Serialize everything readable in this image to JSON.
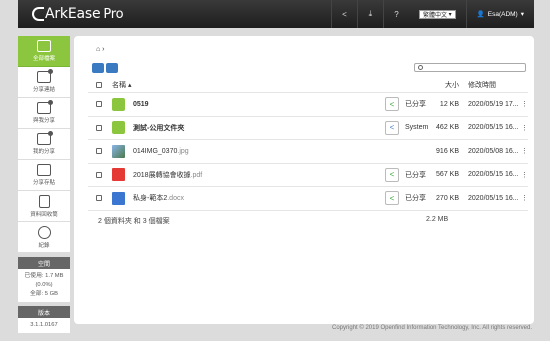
{
  "header": {
    "brand": "ArkEase",
    "brand_suffix": "Pro",
    "language": "繁體中文",
    "user": "Esa(ADM)"
  },
  "sidebar": {
    "items": [
      {
        "label": "全部檔案",
        "icon": "folder-icon"
      },
      {
        "label": "分享連結",
        "icon": "share-link-icon"
      },
      {
        "label": "與我分享",
        "icon": "shared-with-me-icon"
      },
      {
        "label": "我的分享",
        "icon": "my-shares-icon"
      },
      {
        "label": "分享存貼",
        "icon": "share-paste-icon"
      },
      {
        "label": "資料回收筒",
        "icon": "recycle-bin-icon"
      },
      {
        "label": "紀錄",
        "icon": "history-icon"
      }
    ],
    "space_title": "空間",
    "space_used": "已使用: 1.7 MB",
    "space_pct": "(0.0%)",
    "space_total": "全部: 5 GB",
    "version_title": "版本",
    "version": "3.1.1.0167"
  },
  "main": {
    "columns": {
      "name": "名稱",
      "size": "大小",
      "modified": "修改時間"
    },
    "files": [
      {
        "name": "0519",
        "ext": "",
        "type": "folder",
        "bold": true,
        "status": "已分享",
        "share": "green",
        "size": "12 KB",
        "date": "2020/05/19 17..."
      },
      {
        "name": "測試-公用文件夾",
        "ext": "",
        "type": "folder",
        "bold": true,
        "status": "System",
        "share": "blue",
        "size": "462 KB",
        "date": "2020/05/15 16..."
      },
      {
        "name": "014IMG_0370",
        "ext": ".jpg",
        "type": "image",
        "bold": false,
        "status": "",
        "share": "",
        "size": "916 KB",
        "date": "2020/05/08 16..."
      },
      {
        "name": "2018展轉協會收據",
        "ext": ".pdf",
        "type": "pdf",
        "bold": false,
        "status": "已分享",
        "share": "green",
        "size": "567 KB",
        "date": "2020/05/15 16..."
      },
      {
        "name": "私身-範本2",
        "ext": ".docx",
        "type": "doc",
        "bold": false,
        "status": "已分享",
        "share": "green",
        "size": "270 KB",
        "date": "2020/05/15 16..."
      }
    ],
    "summary": "2 個資料夾 和 3 個檔案",
    "total_size": "2.2 MB"
  },
  "footer": "Copyright © 2019 Openfind Information Technology, Inc. All rights reserved.",
  "colors": {
    "accent": "#8cc63f",
    "header": "#2a2a2a",
    "toolbar_button": "#3a7ac0"
  }
}
